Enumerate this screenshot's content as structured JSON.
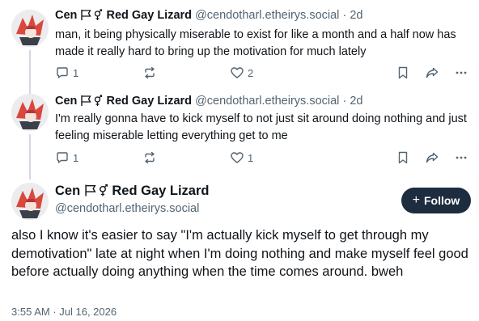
{
  "posts": [
    {
      "display_name": "Cen",
      "flag_text": "Red Gay Lizard",
      "handle": "@cendotharl.etheirys.social",
      "time": "2d",
      "text": "man, it being physically miserable to exist for like a month and a half now has made it really hard to bring up the motivation for much lately",
      "replies": "1",
      "boosts": "",
      "likes": "2"
    },
    {
      "display_name": "Cen",
      "flag_text": "Red Gay Lizard",
      "handle": "@cendotharl.etheirys.social",
      "time": "2d",
      "text": "I'm really gonna have to kick myself to not just sit around doing nothing and just feeling miserable letting everything get to me",
      "replies": "1",
      "boosts": "",
      "likes": "1"
    }
  ],
  "main_post": {
    "display_name": "Cen",
    "flag_text": "Red Gay Lizard",
    "handle": "@cendotharl.etheirys.social",
    "follow_label": "Follow",
    "text": "also I know it's easier to say \"I'm actually kick myself to get through my demotivation\" late at night when I'm doing nothing and make myself feel good before actually doing anything when the time comes around. bweh",
    "timestamp": "3:55 AM · Jul 16, 2026"
  },
  "separator": "·",
  "colors": {
    "text": "#0f1419",
    "muted": "#536471",
    "follow_bg": "#1d2c3f",
    "thread_line": "#d4d8de"
  },
  "icons": [
    "reply-icon",
    "boost-icon",
    "like-icon",
    "bookmark-icon",
    "share-icon",
    "more-icon",
    "flag-icon",
    "transgender-symbol-icon"
  ]
}
